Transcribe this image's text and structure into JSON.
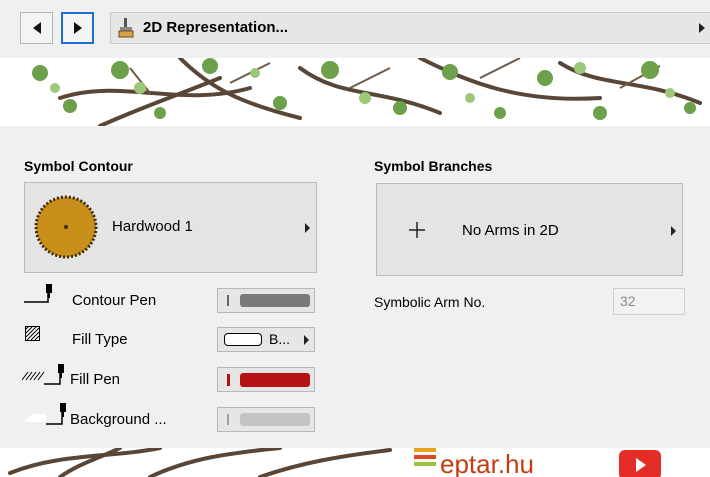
{
  "toolbar": {
    "section_title": "2D Representation..."
  },
  "symbol_contour": {
    "header": "Symbol Contour",
    "selected": "Hardwood 1"
  },
  "symbol_branches": {
    "header": "Symbol Branches",
    "selected": "No Arms in 2D",
    "arm_no_label": "Symbolic Arm No.",
    "arm_no_value": "32"
  },
  "pens": {
    "contour_pen": "Contour Pen",
    "fill_type": "Fill Type",
    "fill_type_value": "B...",
    "fill_pen": "Fill Pen",
    "background": "Background ..."
  },
  "watermark": {
    "site": "eptar.hu"
  },
  "colors": {
    "fill_pen": "#b31313",
    "contour_pen": "#7a7a7a",
    "background_pen": "#c4c4c4",
    "hardwood": "#c8901a"
  }
}
